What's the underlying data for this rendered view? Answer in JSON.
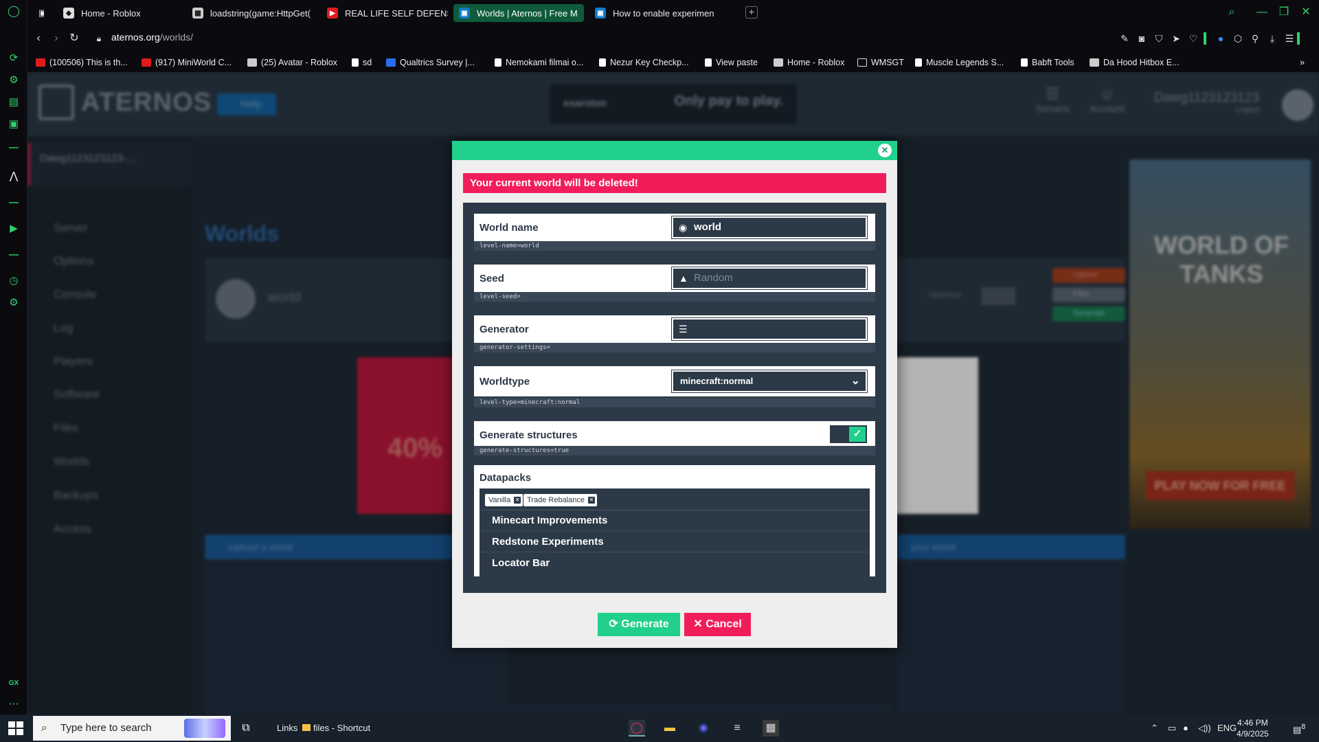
{
  "browser": {
    "tabs": [
      {
        "title": "Home - Roblox",
        "favicon": "roblox-icon",
        "active": false
      },
      {
        "title": "loadstring(game:HttpGet(",
        "favicon": "pastebin-icon",
        "active": false
      },
      {
        "title": "REAL LIFE SELF DEFENSE",
        "favicon": "youtube-icon",
        "active": false
      },
      {
        "title": "Worlds | Aternos | Free M",
        "favicon": "aternos-icon",
        "active": true
      },
      {
        "title": "How to enable experimen",
        "favicon": "aternos-icon",
        "active": false
      }
    ],
    "url_host": "aternos.org",
    "url_path": "/worlds/",
    "bookmarks": [
      "(100506) This is th...",
      "(917) MiniWorld C...",
      "(25) Avatar - Roblox",
      "sd",
      "Qualtrics Survey |...",
      "Nemokami filmai o...",
      "Nezur Key Checkp...",
      "View paste",
      "Home - Roblox",
      "WMSGT",
      "Muscle Legends S...",
      "Babft Tools",
      "Da Hood Hitbox E..."
    ],
    "accent_color": "#2ed36b"
  },
  "site": {
    "logo": "ATERNOS",
    "help": "Help",
    "ad_text": "Only pay to play.",
    "ad_brand": "exaroton",
    "nav_servers": "Servers",
    "nav_account": "Account",
    "username": "Dawg1123123123",
    "logout": "Logout",
    "server_name": "Dawg1123123123-...",
    "sidebar": [
      "Server",
      "Options",
      "Console",
      "Log",
      "Players",
      "Software",
      "Files",
      "Worlds",
      "Backups",
      "Access"
    ],
    "heading": "Worlds",
    "world_card_name": "world",
    "optimize": "Optimize",
    "btn_upload": "Upload",
    "btn_files": "Files",
    "btn_generate": "Generate",
    "upload_title": "Upload a world",
    "download_title": "your world",
    "red_ad_percent": "40%",
    "wot_title": "WORLD OF TANKS",
    "wot_cta": "PLAY NOW FOR FREE"
  },
  "modal": {
    "warning": "Your current world will be deleted!",
    "world_name": {
      "label": "World name",
      "value": "world",
      "property": "level-name=world"
    },
    "seed": {
      "label": "Seed",
      "placeholder": "Random",
      "property": "level-seed="
    },
    "generator": {
      "label": "Generator",
      "value": "",
      "property": "generator-settings="
    },
    "worldtype": {
      "label": "Worldtype",
      "value": "minecraft:normal",
      "property": "level-type=minecraft:normal"
    },
    "structures": {
      "label": "Generate structures",
      "enabled": true,
      "property": "generate-structures=true"
    },
    "datapacks": {
      "label": "Datapacks",
      "selected": [
        "Vanilla",
        "Trade Rebalance"
      ],
      "options": [
        "Minecart Improvements",
        "Redstone Experiments",
        "Locator Bar"
      ]
    },
    "generate_label": "Generate",
    "cancel_label": "Cancel",
    "colors": {
      "green": "#21d08b",
      "red": "#f11d59",
      "panel": "#2c3947"
    }
  },
  "taskbar": {
    "search_placeholder": "Type here to search",
    "links": "Links",
    "files_shortcut": "files - Shortcut",
    "lang": "ENG",
    "time": "4:46 PM",
    "date": "4/9/2025",
    "notifications": "8"
  }
}
